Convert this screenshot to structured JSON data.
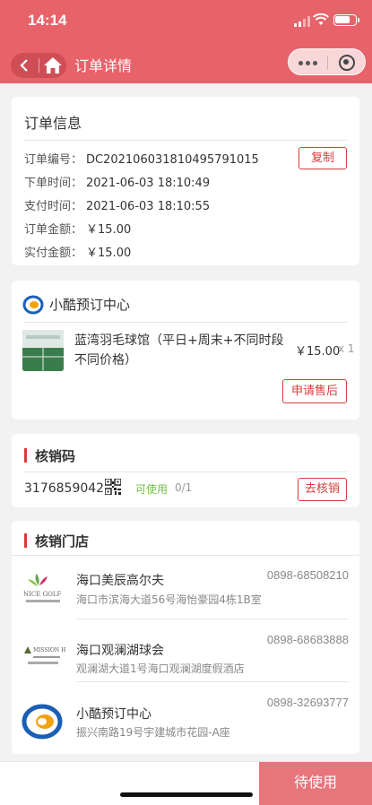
{
  "status_bar": {
    "time": "14:14"
  },
  "header": {
    "title": "订单详情"
  },
  "order_info": {
    "title": "订单信息",
    "order_no_label": "订单编号：",
    "order_no": "DC202106031810495791015",
    "copy_label": "复制",
    "order_time_label": "下单时间：",
    "order_time": "2021-06-03 18:10:49",
    "pay_time_label": "支付时间：",
    "pay_time": "2021-06-03 18:10:55",
    "amount_label": "订单金额：",
    "amount": "￥15.00",
    "paid_label": "实付金额：",
    "paid": "￥15.00"
  },
  "shop": {
    "name": "小酷预订中心",
    "product_name": "蓝湾羽毛球馆（平日+周末+不同时段不同价格）",
    "price": "￥15.00",
    "qty": "x 1",
    "after_sale_label": "申请售后"
  },
  "verify": {
    "title": "核销码",
    "code": "3176859042",
    "status": "可使用",
    "count": "0/1",
    "action_label": "去核销"
  },
  "stores": {
    "title": "核销门店",
    "items": [
      {
        "name": "海口美辰高尔夫",
        "phone": "0898-68508210",
        "address": "海口市滨海大道56号海怡豪园4栋1B室",
        "logo": "golf-logo-icon"
      },
      {
        "name": "海口观澜湖球会",
        "phone": "0898-68683888",
        "address": "观澜湖大道1号海口观澜湖度假酒店",
        "logo": "mission-hills-logo-icon"
      },
      {
        "name": "小酷预订中心",
        "phone": "0898-32693777",
        "address": "振兴南路19号宇建城市花园-A座",
        "logo": "xiaoku-logo-icon"
      }
    ]
  },
  "bottom": {
    "status_button": "待使用"
  },
  "colors": {
    "brand": "#e8626a",
    "accent_red": "#d93b3b",
    "available_green": "#6fbf4a"
  }
}
